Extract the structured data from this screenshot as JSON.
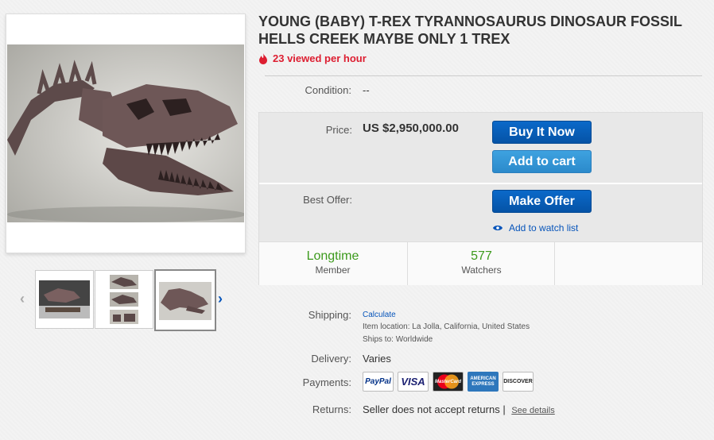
{
  "listing": {
    "title": "YOUNG (BABY) T-REX TYRANNOSAURUS DINOSAUR FOSSIL HELLS CREEK MAYBE ONLY 1 TREX",
    "viewed": "23 viewed per hour",
    "condition_label": "Condition:",
    "condition_value": "--"
  },
  "buybox": {
    "price_label": "Price:",
    "price": "US $2,950,000.00",
    "buy_now": "Buy It Now",
    "add_to_cart": "Add to cart",
    "best_offer_label": "Best Offer:",
    "make_offer": "Make Offer",
    "watch": "Add to watch list",
    "stats": [
      {
        "big": "Longtime",
        "small": "Member"
      },
      {
        "big": "577",
        "small": "Watchers"
      }
    ]
  },
  "details": {
    "shipping_label": "Shipping:",
    "shipping_link": "Calculate",
    "item_location_label": "Item location:",
    "item_location": "La Jolla, California, United States",
    "ships_to_label": "Ships to:",
    "ships_to": "Worldwide",
    "delivery_label": "Delivery:",
    "delivery": "Varies",
    "payments_label": "Payments:",
    "payment_methods": [
      "PayPal",
      "VISA",
      "MasterCard",
      "AMERICAN EXPRESS",
      "DISCOVER"
    ],
    "returns_label": "Returns:",
    "returns": "Seller does not accept returns |",
    "see_details": "See details"
  },
  "icons": {
    "prev": "chevron-left-icon",
    "next": "chevron-right-icon",
    "fire": "fire-icon",
    "eye": "eye-icon"
  },
  "colors": {
    "accent": "#0654ba",
    "alert": "#dd1e31",
    "green": "#3c9a1c"
  }
}
